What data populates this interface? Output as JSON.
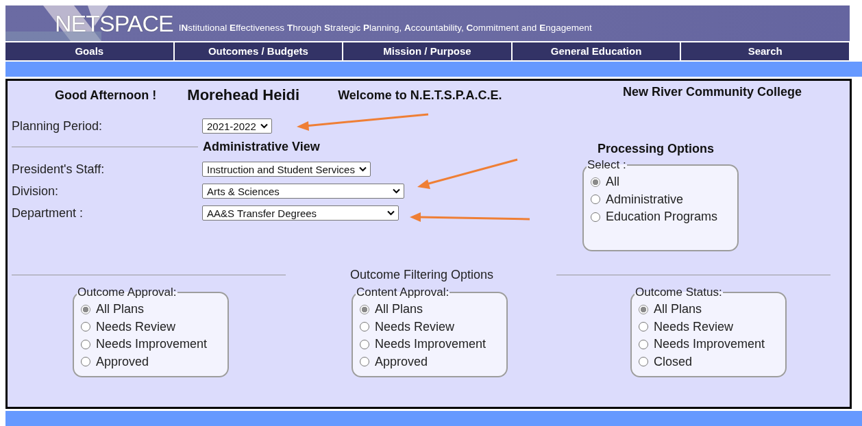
{
  "header": {
    "logo": "NETSPACE",
    "tagline": "I**N**stitutional **E**ffectiveness **T**hrough **S**trategic **P**lanning, **A**ccountability, **C**ommitment and **E**ngagement"
  },
  "nav": [
    {
      "label": "Goals"
    },
    {
      "label": "Outcomes / Budgets"
    },
    {
      "label": "Mission / Purpose"
    },
    {
      "label": "General Education"
    },
    {
      "label": "Search"
    }
  ],
  "greeting": "Good Afternoon !",
  "user_name": "Morehead Heidi",
  "welcome": "Welcome to N.E.T.S.P.A.C.E.",
  "college": "New River Community College",
  "planning_period": {
    "label": "Planning Period:",
    "value": "2021-2022"
  },
  "administrative_view": {
    "title": "Administrative View",
    "fields": [
      {
        "label": "President's Staff:",
        "value": "Instruction and Student Services"
      },
      {
        "label": "Division:",
        "value": "Arts & Sciences"
      },
      {
        "label": "Department :",
        "value": "AA&S Transfer Degrees"
      }
    ]
  },
  "processing_options": {
    "title": "Processing Options",
    "legend": "Select :",
    "options": [
      {
        "label": "All",
        "selected": true
      },
      {
        "label": "Administrative",
        "selected": false
      },
      {
        "label": "Education Programs",
        "selected": false
      }
    ]
  },
  "outcome_filtering": {
    "title": "Outcome Filtering Options",
    "groups": [
      {
        "legend": "Outcome Approval:",
        "options": [
          {
            "label": "All Plans",
            "selected": true
          },
          {
            "label": "Needs Review",
            "selected": false
          },
          {
            "label": "Needs Improvement",
            "selected": false
          },
          {
            "label": "Approved",
            "selected": false
          }
        ]
      },
      {
        "legend": "Content Approval:",
        "options": [
          {
            "label": "All Plans",
            "selected": true
          },
          {
            "label": "Needs Review",
            "selected": false
          },
          {
            "label": "Needs Improvement",
            "selected": false
          },
          {
            "label": "Approved",
            "selected": false
          }
        ]
      },
      {
        "legend": "Outcome Status:",
        "options": [
          {
            "label": "All Plans",
            "selected": true
          },
          {
            "label": "Needs Review",
            "selected": false
          },
          {
            "label": "Needs Improvement",
            "selected": false
          },
          {
            "label": "Closed",
            "selected": false
          }
        ]
      }
    ]
  }
}
